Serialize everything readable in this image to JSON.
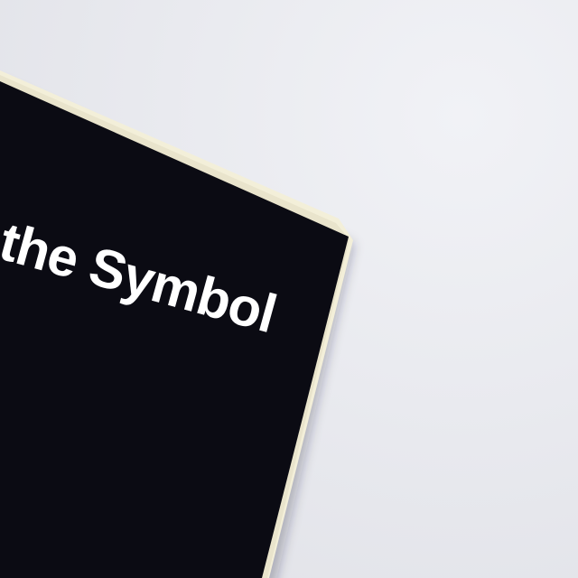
{
  "book": {
    "cover_title_fragment": "f the Symbol",
    "cover_color": "#0b0b13",
    "page_edge_color": "#f3efd9",
    "text_color": "#ffffff"
  },
  "background": {
    "surface_color": "#e8e9ee"
  }
}
